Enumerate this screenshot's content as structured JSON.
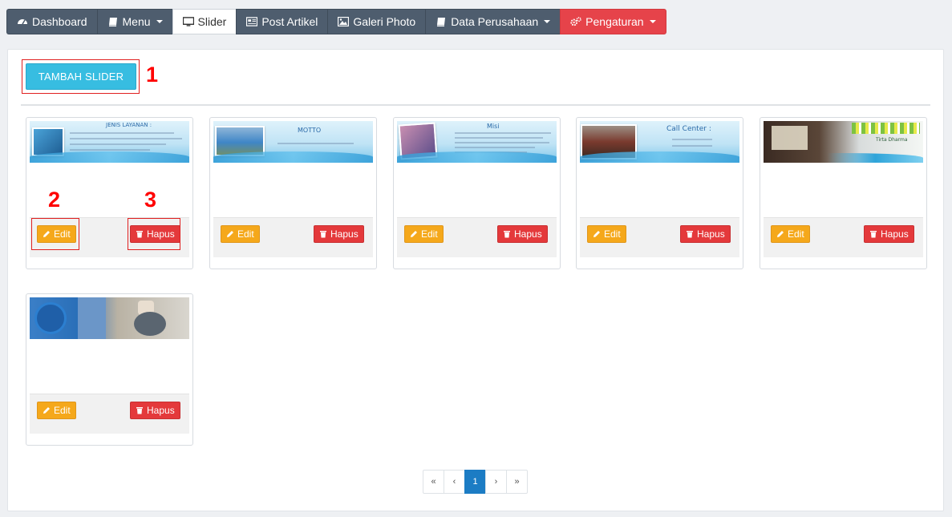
{
  "nav": {
    "items": [
      {
        "label": "Dashboard",
        "icon": "dashboard-icon"
      },
      {
        "label": "Menu",
        "icon": "book-icon",
        "dropdown": true
      },
      {
        "label": "Slider",
        "icon": "monitor-icon",
        "active": true
      },
      {
        "label": "Post Artikel",
        "icon": "newspaper-icon"
      },
      {
        "label": "Galeri Photo",
        "icon": "image-icon"
      },
      {
        "label": "Data Perusahaan",
        "icon": "book-icon",
        "dropdown": true
      },
      {
        "label": "Pengaturan",
        "icon": "gears-icon",
        "dropdown": true
      }
    ]
  },
  "toolbar": {
    "add_label": "TAMBAH SLIDER"
  },
  "annotations": {
    "one": "1",
    "two": "2",
    "three": "3"
  },
  "slides": [
    {
      "caption": "JENIS LAYANAN :",
      "edit_label": "Edit",
      "delete_label": "Hapus"
    },
    {
      "caption": "MOTTO",
      "edit_label": "Edit",
      "delete_label": "Hapus"
    },
    {
      "caption": "Misi",
      "edit_label": "Edit",
      "delete_label": "Hapus"
    },
    {
      "caption": "Call Center :",
      "edit_label": "Edit",
      "delete_label": "Hapus"
    },
    {
      "caption": "Tirta Dharma",
      "edit_label": "Edit",
      "delete_label": "Hapus"
    },
    {
      "caption": "",
      "edit_label": "Edit",
      "delete_label": "Hapus"
    }
  ],
  "pagination": {
    "first": "«",
    "prev": "‹",
    "current": "1",
    "next": "›",
    "last": "»"
  },
  "colors": {
    "nav": "#4e5d6e",
    "danger": "#e6434a",
    "info": "#37bde1",
    "warning": "#f5a81b",
    "primary": "#1c7cc4"
  }
}
